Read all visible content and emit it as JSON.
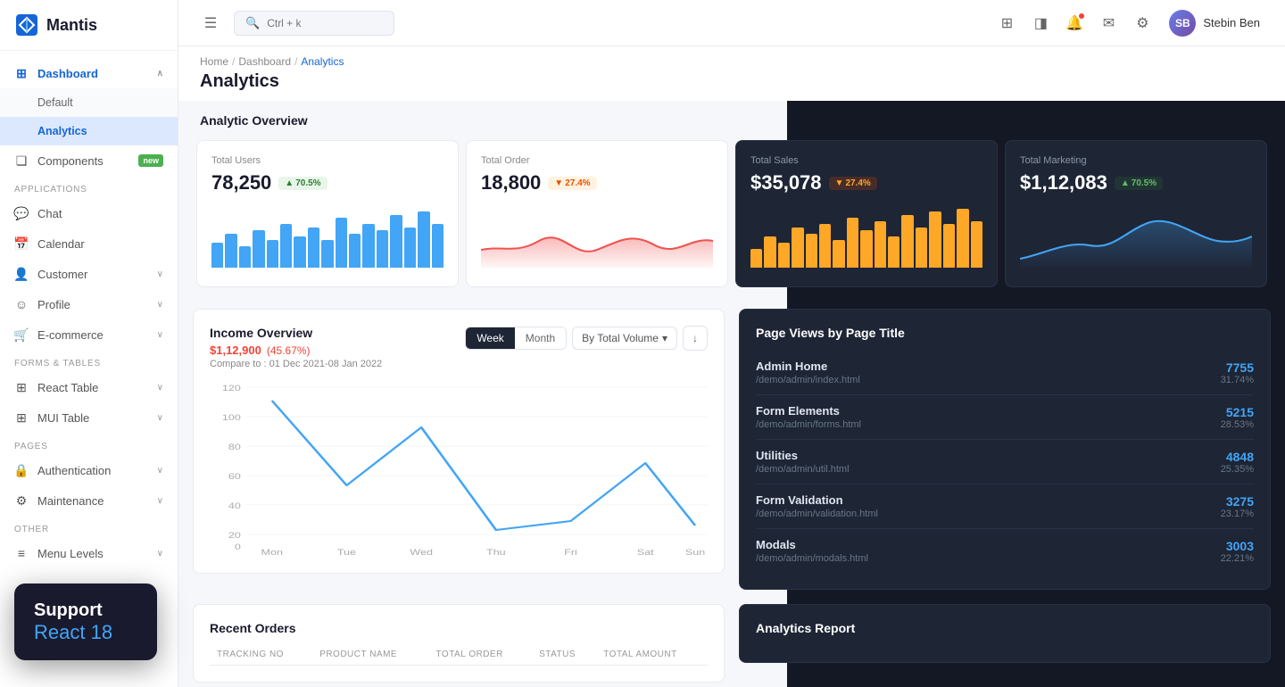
{
  "brand": {
    "name": "Mantis",
    "logo_symbol": "◇"
  },
  "topbar": {
    "search_placeholder": "Ctrl + k",
    "user_name": "Stebin Ben",
    "user_initials": "SB"
  },
  "breadcrumb": {
    "items": [
      "Home",
      "Dashboard",
      "Analytics"
    ]
  },
  "page": {
    "title": "Analytics",
    "section_analytic": "Analytic Overview",
    "section_income": "Income Overview",
    "section_page_views": "Page Views by Page Title",
    "section_orders": "Recent Orders",
    "section_analytics_report": "Analytics Report"
  },
  "sidebar": {
    "dashboard_label": "Dashboard",
    "sub_default": "Default",
    "sub_analytics": "Analytics",
    "components_label": "Components",
    "components_badge": "new",
    "applications_label": "Applications",
    "chat_label": "Chat",
    "calendar_label": "Calendar",
    "customer_label": "Customer",
    "profile_label": "Profile",
    "ecommerce_label": "E-commerce",
    "forms_tables_label": "Forms & Tables",
    "react_table_label": "React Table",
    "mui_table_label": "MUI Table",
    "pages_label": "Pages",
    "authentication_label": "Authentication",
    "maintenance_label": "Maintenance",
    "other_label": "Other",
    "menu_levels_label": "Menu Levels"
  },
  "stats": [
    {
      "title": "Total Users",
      "value": "78,250",
      "badge": "70.5%",
      "badge_type": "up",
      "dark": false,
      "bars": [
        40,
        55,
        35,
        60,
        45,
        70,
        50,
        65,
        45,
        80,
        55,
        70,
        60,
        85,
        65,
        90,
        70
      ]
    },
    {
      "title": "Total Order",
      "value": "18,800",
      "badge": "27.4%",
      "badge_type": "down",
      "dark": false,
      "is_area": true
    },
    {
      "title": "Total Sales",
      "value": "$35,078",
      "badge": "27.4%",
      "badge_type": "down",
      "dark": true,
      "bars": [
        30,
        50,
        40,
        65,
        55,
        70,
        45,
        80,
        60,
        75,
        50,
        85,
        65,
        90,
        70,
        95,
        75
      ]
    },
    {
      "title": "Total Marketing",
      "value": "$1,12,083",
      "badge": "70.5%",
      "badge_type": "up",
      "dark": true,
      "is_area": true,
      "area_dark": true
    }
  ],
  "income": {
    "value": "$1,12,900",
    "pct": "(45.67%)",
    "compare": "Compare to : 01 Dec 2021-08 Jan 2022",
    "btn_week": "Week",
    "btn_month": "Month",
    "btn_volume": "By Total Volume",
    "y_labels": [
      "120",
      "100",
      "80",
      "60",
      "40",
      "20",
      "0"
    ],
    "x_labels": [
      "Mon",
      "Tue",
      "Wed",
      "Thu",
      "Fri",
      "Sat",
      "Sun"
    ]
  },
  "page_views": [
    {
      "title": "Admin Home",
      "url": "/demo/admin/index.html",
      "count": "7755",
      "pct": "31.74%"
    },
    {
      "title": "Form Elements",
      "url": "/demo/admin/forms.html",
      "count": "5215",
      "pct": "28.53%"
    },
    {
      "title": "Utilities",
      "url": "/demo/admin/util.html",
      "count": "4848",
      "pct": "25.35%"
    },
    {
      "title": "Form Validation",
      "url": "/demo/admin/validation.html",
      "count": "3275",
      "pct": "23.17%"
    },
    {
      "title": "Modals",
      "url": "/demo/admin/modals.html",
      "count": "3003",
      "pct": "22.21%"
    }
  ],
  "orders": {
    "columns": [
      "TRACKING NO",
      "PRODUCT NAME",
      "TOTAL ORDER",
      "STATUS",
      "TOTAL AMOUNT"
    ]
  },
  "support_toast": {
    "line1": "Support",
    "line2": "React 18"
  }
}
